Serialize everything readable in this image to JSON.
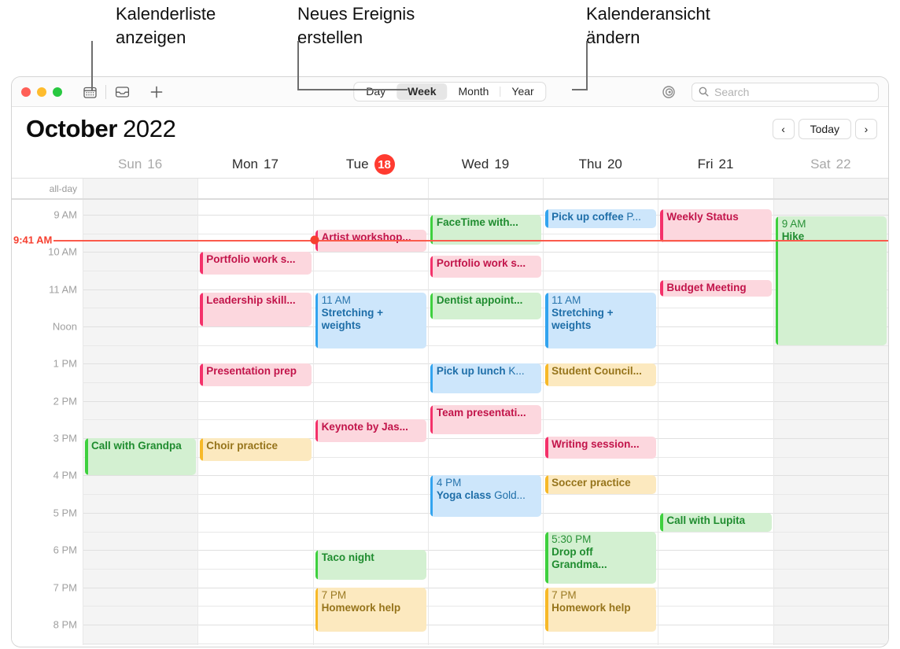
{
  "callouts": [
    {
      "text": "Kalenderliste\nanzeigen"
    },
    {
      "text": "Neues Ereignis\nerstellen"
    },
    {
      "text": "Kalenderansicht\nändern"
    }
  ],
  "toolbar": {
    "calendar_list_icon": "calendar-grid-icon",
    "inbox_icon": "inbox-tray-icon",
    "new_event_icon": "plus-icon",
    "share_icon": "airplay-share-icon",
    "search_placeholder": "Search",
    "views": [
      {
        "label": "Day",
        "active": false
      },
      {
        "label": "Week",
        "active": true
      },
      {
        "label": "Month",
        "active": false
      },
      {
        "label": "Year",
        "active": false
      }
    ]
  },
  "header": {
    "month": "October",
    "year": "2022",
    "prev_label": "‹",
    "today_label": "Today",
    "next_label": "›"
  },
  "grid": {
    "allday_label": "all-day",
    "time_ticks": [
      "9 AM",
      "10 AM",
      "11 AM",
      "Noon",
      "1 PM",
      "2 PM",
      "3 PM",
      "4 PM",
      "5 PM",
      "6 PM",
      "7 PM",
      "8 PM"
    ],
    "now": {
      "label": "9:41 AM"
    }
  },
  "days": [
    {
      "name": "Sun",
      "date": "16",
      "weekend": true,
      "today": false
    },
    {
      "name": "Mon",
      "date": "17",
      "weekend": false,
      "today": false
    },
    {
      "name": "Tue",
      "date": "18",
      "weekend": false,
      "today": true
    },
    {
      "name": "Wed",
      "date": "19",
      "weekend": false,
      "today": false
    },
    {
      "name": "Thu",
      "date": "20",
      "weekend": false,
      "today": false
    },
    {
      "name": "Fri",
      "date": "21",
      "weekend": false,
      "today": false
    },
    {
      "name": "Sat",
      "date": "22",
      "weekend": true,
      "today": false
    }
  ],
  "events": [
    {
      "day": 0,
      "title": "Call with Grandpa",
      "time": "",
      "sub": "",
      "color": "green",
      "start": 15.0,
      "end": 16.0
    },
    {
      "day": 1,
      "title": "Portfolio work s...",
      "time": "",
      "sub": "",
      "color": "pink",
      "start": 10.0,
      "end": 10.6
    },
    {
      "day": 1,
      "title": "Leadership skill...",
      "time": "",
      "sub": "",
      "color": "pink",
      "start": 11.1,
      "end": 12.0
    },
    {
      "day": 1,
      "title": "Presentation prep",
      "time": "",
      "sub": "",
      "color": "pink",
      "start": 13.0,
      "end": 13.6
    },
    {
      "day": 1,
      "title": "Choir practice",
      "time": "",
      "sub": "",
      "color": "yellow",
      "start": 15.0,
      "end": 15.6
    },
    {
      "day": 2,
      "title": "Artist workshop...",
      "time": "",
      "sub": "",
      "color": "pink",
      "start": 9.4,
      "end": 10.0
    },
    {
      "day": 2,
      "title": "Stretching +\nweights",
      "time": "11 AM",
      "sub": "",
      "color": "blue",
      "start": 11.1,
      "end": 12.6
    },
    {
      "day": 2,
      "title": "Keynote by Jas...",
      "time": "",
      "sub": "",
      "color": "pink",
      "start": 14.5,
      "end": 15.1
    },
    {
      "day": 2,
      "title": "Taco night",
      "time": "",
      "sub": "",
      "color": "green",
      "start": 18.0,
      "end": 18.8
    },
    {
      "day": 2,
      "title": "Homework help",
      "time": "7 PM",
      "sub": "",
      "color": "yellow",
      "start": 19.0,
      "end": 20.2
    },
    {
      "day": 3,
      "title": "FaceTime with...",
      "time": "",
      "sub": "",
      "color": "green",
      "start": 9.0,
      "end": 9.8
    },
    {
      "day": 3,
      "title": "Portfolio work s...",
      "time": "",
      "sub": "",
      "color": "pink",
      "start": 10.1,
      "end": 10.7
    },
    {
      "day": 3,
      "title": "Dentist appoint...",
      "time": "",
      "sub": "",
      "color": "green",
      "start": 11.1,
      "end": 11.8
    },
    {
      "day": 3,
      "title": "Pick up lunch",
      "time": "",
      "sub": "K...",
      "color": "blue",
      "start": 13.0,
      "end": 13.8
    },
    {
      "day": 3,
      "title": "Team presentati...",
      "time": "",
      "sub": "",
      "color": "pink",
      "start": 14.1,
      "end": 14.9
    },
    {
      "day": 3,
      "title": "Yoga class",
      "time": "4 PM",
      "sub": "Gold...",
      "color": "blue",
      "start": 16.0,
      "end": 17.1
    },
    {
      "day": 4,
      "title": "Pick up coffee",
      "time": "",
      "sub": "P...",
      "color": "blue",
      "start": 8.85,
      "end": 9.35
    },
    {
      "day": 4,
      "title": "Stretching +\nweights",
      "time": "11 AM",
      "sub": "",
      "color": "blue",
      "start": 11.1,
      "end": 12.6
    },
    {
      "day": 4,
      "title": "Student Council...",
      "time": "",
      "sub": "",
      "color": "yellow",
      "start": 13.0,
      "end": 13.6
    },
    {
      "day": 4,
      "title": "Writing session...",
      "time": "",
      "sub": "",
      "color": "pink",
      "start": 14.95,
      "end": 15.55
    },
    {
      "day": 4,
      "title": "Soccer practice",
      "time": "",
      "sub": "",
      "color": "yellow",
      "start": 16.0,
      "end": 16.5
    },
    {
      "day": 4,
      "title": "Drop off\nGrandma...",
      "time": "5:30 PM",
      "sub": "",
      "color": "green",
      "start": 17.5,
      "end": 18.9
    },
    {
      "day": 4,
      "title": "Homework help",
      "time": "7 PM",
      "sub": "",
      "color": "yellow",
      "start": 19.0,
      "end": 20.2
    },
    {
      "day": 5,
      "title": "Weekly Status",
      "time": "",
      "sub": "",
      "color": "pink",
      "start": 8.85,
      "end": 9.75
    },
    {
      "day": 5,
      "title": "Budget Meeting",
      "time": "",
      "sub": "",
      "color": "pink",
      "start": 10.75,
      "end": 11.2
    },
    {
      "day": 5,
      "title": "Call with Lupita",
      "time": "",
      "sub": "",
      "color": "green",
      "start": 17.0,
      "end": 17.5
    },
    {
      "day": 6,
      "title": "Hike",
      "time": "9 AM",
      "sub": "",
      "color": "green",
      "start": 9.05,
      "end": 12.5
    }
  ]
}
